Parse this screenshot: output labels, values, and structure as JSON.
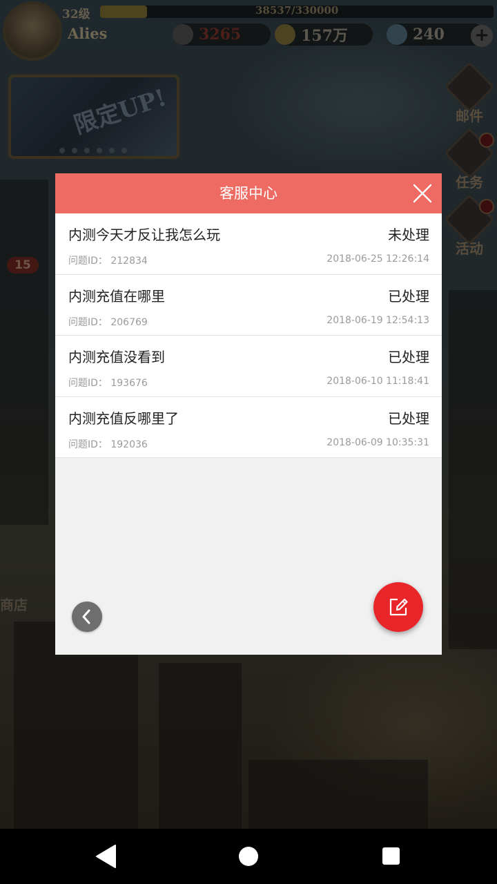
{
  "hud": {
    "level": "32级",
    "xp": "38537/330000",
    "xp_fraction": 0.12,
    "player_name": "Alies",
    "power": "3265",
    "gold": "157万",
    "gems": "240",
    "plus": "+"
  },
  "banner": {
    "text": "限定UP!"
  },
  "side_buttons": {
    "mail": "邮件",
    "tasks": "任务",
    "events": "活动"
  },
  "level_badge": "15",
  "shop_label": "商店",
  "dialog": {
    "title": "客服中心",
    "tickets": [
      {
        "title": "内测今天才反让我怎么玩",
        "status": "未处理",
        "id": "问题ID： 212834",
        "time": "2018-06-25 12:26:14"
      },
      {
        "title": "内测充值在哪里",
        "status": "已处理",
        "id": "问题ID： 206769",
        "time": "2018-06-19 12:54:13"
      },
      {
        "title": "内测充值没看到",
        "status": "已处理",
        "id": "问题ID： 193676",
        "time": "2018-06-10 11:18:41"
      },
      {
        "title": "内测充值反哪里了",
        "status": "已处理",
        "id": "问题ID： 192036",
        "time": "2018-06-09 10:35:31"
      }
    ]
  },
  "colors": {
    "header": "#ee6b63",
    "compose_button": "#e8262a",
    "back_button": "#6e6e6e",
    "dialog_bg": "#f1f1f1"
  },
  "icons": {
    "close": "close-icon",
    "back": "chevron-left-icon",
    "compose": "edit-icon",
    "nav_back": "triangle-back-icon",
    "nav_home": "circle-home-icon",
    "nav_recent": "square-recent-icon"
  }
}
